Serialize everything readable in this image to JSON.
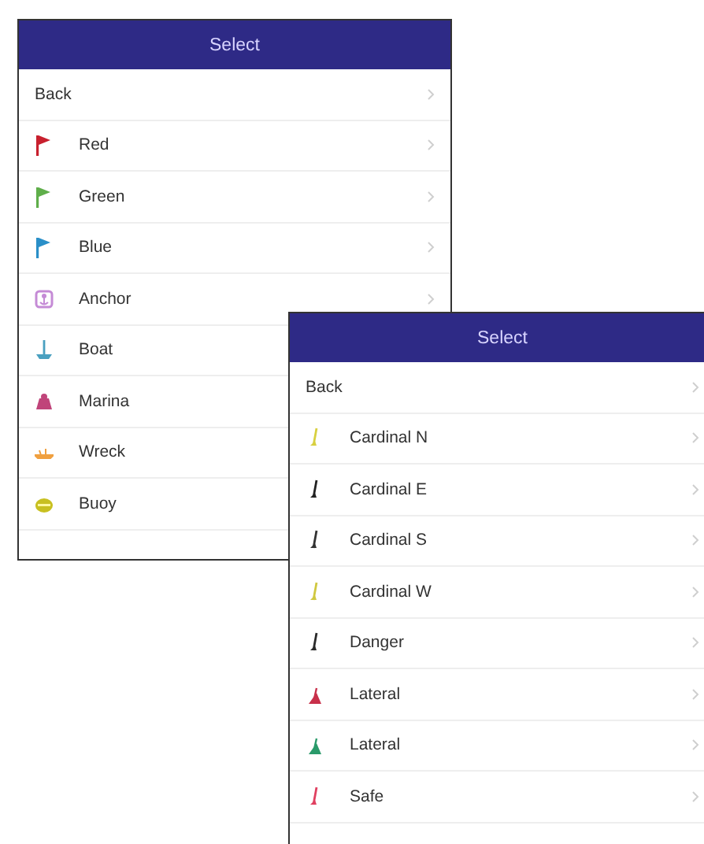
{
  "panels": [
    {
      "title": "Select",
      "back": "Back",
      "items": [
        {
          "kind": "flag",
          "label": "Red",
          "color": "#c8202e"
        },
        {
          "kind": "flag",
          "label": "Green",
          "color": "#5fae4a"
        },
        {
          "kind": "flag",
          "label": "Blue",
          "color": "#2a8fc8"
        },
        {
          "kind": "anchor",
          "label": "Anchor",
          "color": "#c58bd6"
        },
        {
          "kind": "boat",
          "label": "Boat",
          "color": "#4aa0c0"
        },
        {
          "kind": "marina",
          "label": "Marina",
          "color": "#c0447a"
        },
        {
          "kind": "wreck",
          "label": "Wreck",
          "color": "#f0a040"
        },
        {
          "kind": "buoy",
          "label": "Buoy",
          "color": "#c8c020"
        }
      ]
    },
    {
      "title": "Select",
      "back": "Back",
      "items": [
        {
          "kind": "pole",
          "label": "Cardinal N",
          "color": "#d8d040"
        },
        {
          "kind": "pole",
          "label": "Cardinal E",
          "color": "#222222"
        },
        {
          "kind": "pole",
          "label": "Cardinal S",
          "color": "#333333"
        },
        {
          "kind": "pole",
          "label": "Cardinal W",
          "color": "#d0c840"
        },
        {
          "kind": "pole",
          "label": "Danger",
          "color": "#2a2a2a"
        },
        {
          "kind": "cone",
          "label": "Lateral",
          "color": "#c8304a"
        },
        {
          "kind": "cone",
          "label": "Lateral",
          "color": "#2a9a6a"
        },
        {
          "kind": "pole",
          "label": "Safe",
          "color": "#e04060"
        }
      ]
    }
  ]
}
